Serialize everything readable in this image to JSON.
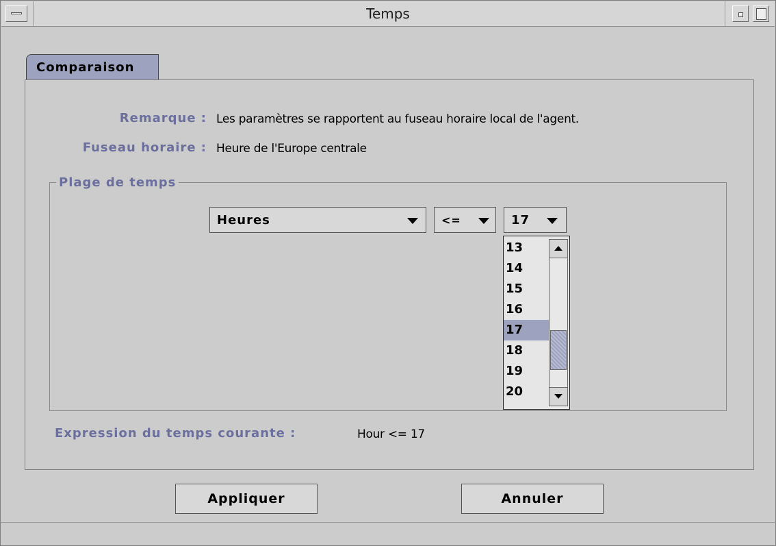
{
  "window": {
    "title": "Temps"
  },
  "tabs": [
    {
      "label": "Comparaison",
      "selected": true
    }
  ],
  "info": {
    "note_label": "Remarque :",
    "note_value": "Les paramètres se rapportent au fuseau horaire local de l'agent.",
    "timezone_label": "Fuseau horaire :",
    "timezone_value": "Heure de l'Europe centrale"
  },
  "time_range": {
    "group_title": "Plage de temps",
    "unit_selected": "Heures",
    "operator_selected": "<=",
    "value_selected": "17",
    "value_options_visible": [
      "13",
      "14",
      "15",
      "16",
      "17",
      "18",
      "19",
      "20"
    ]
  },
  "expression": {
    "label": "Expression du temps courante :",
    "value": "Hour <= 17"
  },
  "buttons": {
    "apply": "Appliquer",
    "cancel": "Annuler"
  },
  "colors": {
    "label_text": "#6b6f9e",
    "selection": "#9da3bf",
    "background": "#cccccc"
  }
}
